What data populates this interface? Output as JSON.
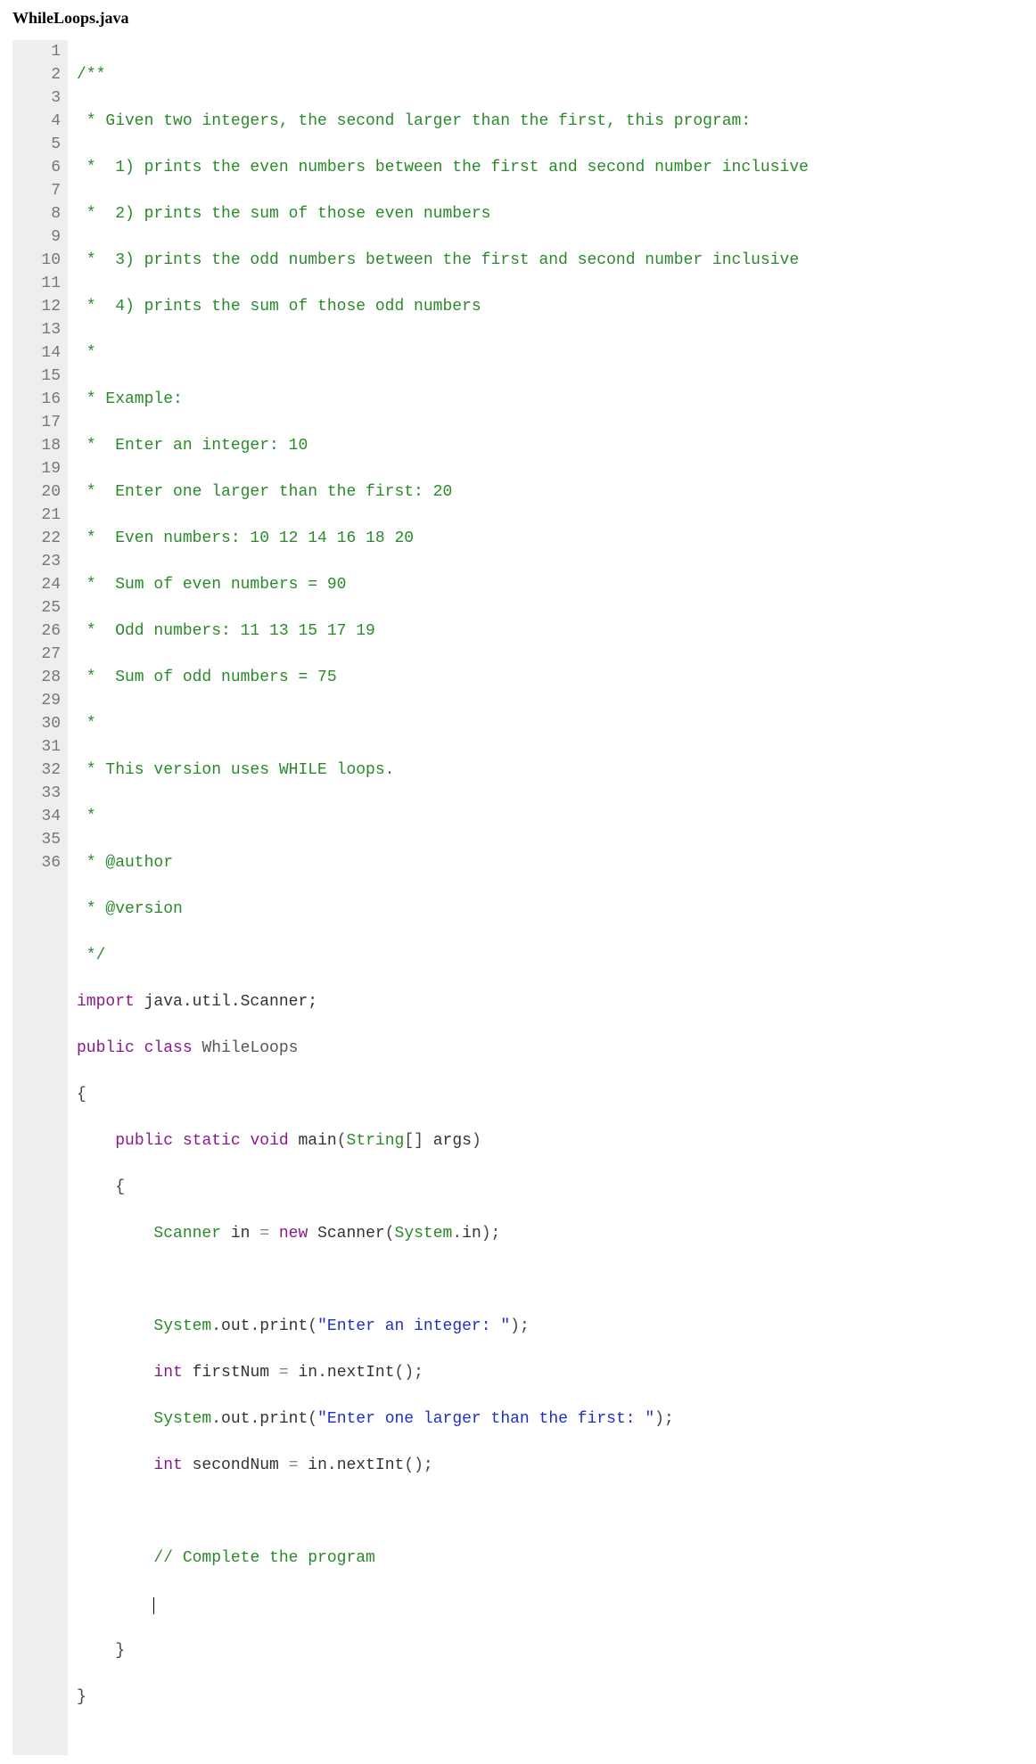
{
  "file": {
    "title": "WhileLoops.java"
  },
  "gutter": {
    "start": 1,
    "end": 36
  },
  "code": {
    "comment": {
      "l1": "/**",
      "l2": " * Given two integers, the second larger than the first, this program:",
      "l3": " *  1) prints the even numbers between the first and second number inclusive",
      "l4": " *  2) prints the sum of those even numbers",
      "l5": " *  3) prints the odd numbers between the first and second number inclusive",
      "l6": " *  4) prints the sum of those odd numbers",
      "l7": " * ",
      "l8": " * Example:",
      "l9": " *  Enter an integer: 10",
      "l10": " *  Enter one larger than the first: 20",
      "l11": " *  Even numbers: 10 12 14 16 18 20",
      "l12": " *  Sum of even numbers = 90",
      "l13": " *  Odd numbers: 11 13 15 17 19",
      "l14": " *  Sum of odd numbers = 75",
      "l15": " * ",
      "l16": " * This version uses WHILE loops.",
      "l17": " * ",
      "l18": " * @author ",
      "l19": " * @version ",
      "l20": " */"
    },
    "kw": {
      "import": "import",
      "public": "public",
      "class": "class",
      "static": "static",
      "void": "void",
      "new": "new",
      "int": "int"
    },
    "names": {
      "pkg": " java.util.Scanner;",
      "className": " WhileLoops",
      "main": " main",
      "String": "String",
      "args": " args",
      "Scanner": "Scanner",
      "inVar": " in ",
      "ScannerCall": " Scanner",
      "System": "System",
      "in": "in",
      "out": "out",
      "print": "print",
      "firstNum": " firstNum ",
      "secondNum": " secondNum ",
      "nextInt": "nextInt"
    },
    "strings": {
      "s1": "\"Enter an integer: \"",
      "s2": "\"Enter one larger than the first: \""
    },
    "punct": {
      "openBrace": "{",
      "closeBrace": "}",
      "openParen": "(",
      "closeParen": ")",
      "brackets": "[]",
      "closeParenSemi": ");",
      "empty": "()",
      "emptySemi": "();",
      "dot": ".",
      "eq": "= ",
      "eqsp": " = ",
      "space4": "    ",
      "space8": "        ",
      "closeBraceIndent4": "    }"
    },
    "inlineComment": "// Complete the program"
  },
  "colors": {
    "gutterBg": "#eeeeee",
    "gutterFg": "#777777",
    "comment": "#2a8a2a",
    "keyword": "#8b1a89",
    "string": "#1f2fbf"
  }
}
